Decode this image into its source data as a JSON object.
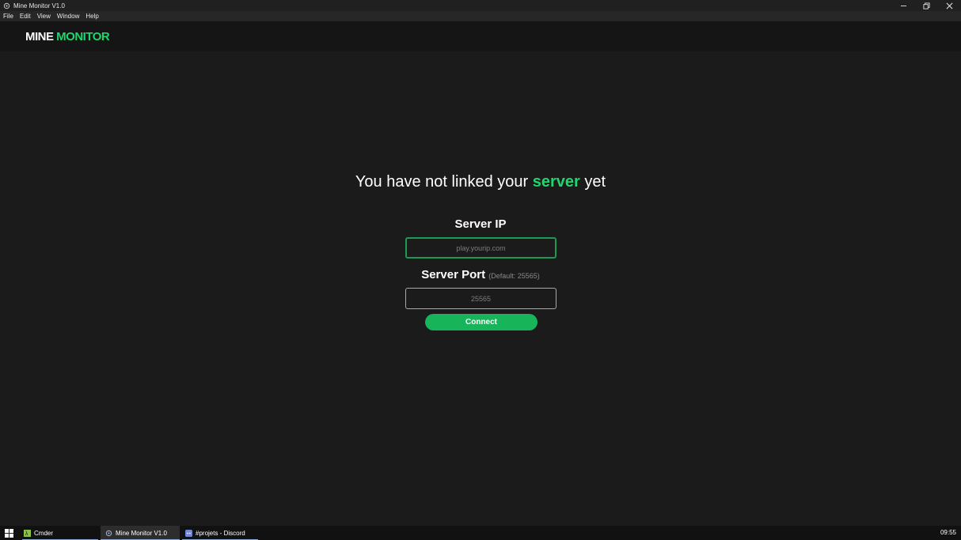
{
  "window": {
    "title": "Mine Monitor V1.0"
  },
  "menu": {
    "items": [
      "File",
      "Edit",
      "View",
      "Window",
      "Help"
    ]
  },
  "header": {
    "logo_part1": "MINE",
    "logo_part2": "MONITOR"
  },
  "main": {
    "headline_pre": "You have not linked your",
    "headline_accent": "server",
    "headline_post": "yet",
    "server_ip_label": "Server IP",
    "server_ip_placeholder": "play.yourip.com",
    "server_port_label": "Server Port",
    "server_port_hint": "(Default: 25565)",
    "server_port_placeholder": "25565",
    "connect_label": "Connect"
  },
  "taskbar": {
    "apps": [
      "Cmder",
      "Mine Monitor V1.0",
      "#projets - Discord"
    ],
    "clock": "09:55"
  },
  "colors": {
    "accent": "#1fd66e",
    "button": "#17b45a",
    "background": "#1b1b1b"
  },
  "icons": [
    "app-icon",
    "minimize-icon",
    "maximize-icon",
    "close-icon",
    "windows-start-icon",
    "cmder-icon",
    "mine-monitor-icon",
    "discord-icon"
  ]
}
